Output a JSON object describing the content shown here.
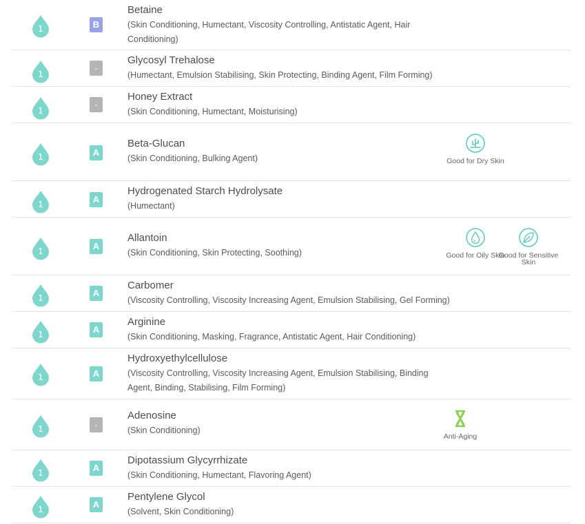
{
  "ingredients": [
    {
      "score": "1",
      "grade": "B",
      "name": "Betaine",
      "functions": "(Skin Conditioning, Humectant, Viscosity Controlling, Antistatic Agent, Hair Conditioning)"
    },
    {
      "score": "1",
      "grade": "-",
      "name": "Glycosyl Trehalose",
      "functions": "(Humectant, Emulsion Stabilising, Skin Protecting, Binding Agent, Film Forming)"
    },
    {
      "score": "1",
      "grade": "-",
      "name": "Honey Extract",
      "functions": "(Skin Conditioning, Humectant, Moisturising)"
    },
    {
      "score": "1",
      "grade": "A",
      "name": "Beta-Glucan",
      "functions": "(Skin Conditioning, Bulking Agent)",
      "tags": [
        {
          "icon": "cactus-icon",
          "label": "Good for Dry Skin"
        }
      ]
    },
    {
      "score": "1",
      "grade": "A",
      "name": "Hydrogenated Starch Hydrolysate",
      "functions": "(Humectant)"
    },
    {
      "score": "1",
      "grade": "A",
      "name": "Allantoin",
      "functions": "(Skin Conditioning, Skin Protecting, Soothing)",
      "tags": [
        {
          "icon": "oil-drop-icon",
          "label": "Good for Oily Skin"
        },
        {
          "icon": "leaf-icon",
          "label": "Good for Sensitive Skin"
        }
      ]
    },
    {
      "score": "1",
      "grade": "A",
      "name": "Carbomer",
      "functions": "(Viscosity Controlling, Viscosity Increasing Agent, Emulsion Stabilising, Gel Forming)"
    },
    {
      "score": "1",
      "grade": "A",
      "name": "Arginine",
      "functions": "(Skin Conditioning, Masking, Fragrance, Antistatic Agent, Hair Conditioning)"
    },
    {
      "score": "1",
      "grade": "A",
      "name": "Hydroxyethylcellulose",
      "functions": "(Viscosity Controlling, Viscosity Increasing Agent, Emulsion Stabilising, Binding Agent, Binding, Stabilising, Film Forming)"
    },
    {
      "score": "1",
      "grade": "-",
      "name": "Adenosine",
      "functions": "(Skin Conditioning)",
      "tags": [
        {
          "icon": "hourglass-icon",
          "label": "Anti-Aging"
        }
      ]
    },
    {
      "score": "1",
      "grade": "A",
      "name": "Dipotassium Glycyrrhizate",
      "functions": "(Skin Conditioning, Humectant, Flavoring Agent)"
    },
    {
      "score": "1",
      "grade": "A",
      "name": "Pentylene Glycol",
      "functions": "(Solvent, Skin Conditioning)"
    }
  ],
  "colors": {
    "drop": "#7fd6cc",
    "grade_a": "#7fd6cc",
    "grade_b": "#9aa2ea",
    "grade_none": "#b5b5b5",
    "tag_icon": "#6fcfc4",
    "anti_aging_icon": "#8ccf55"
  }
}
